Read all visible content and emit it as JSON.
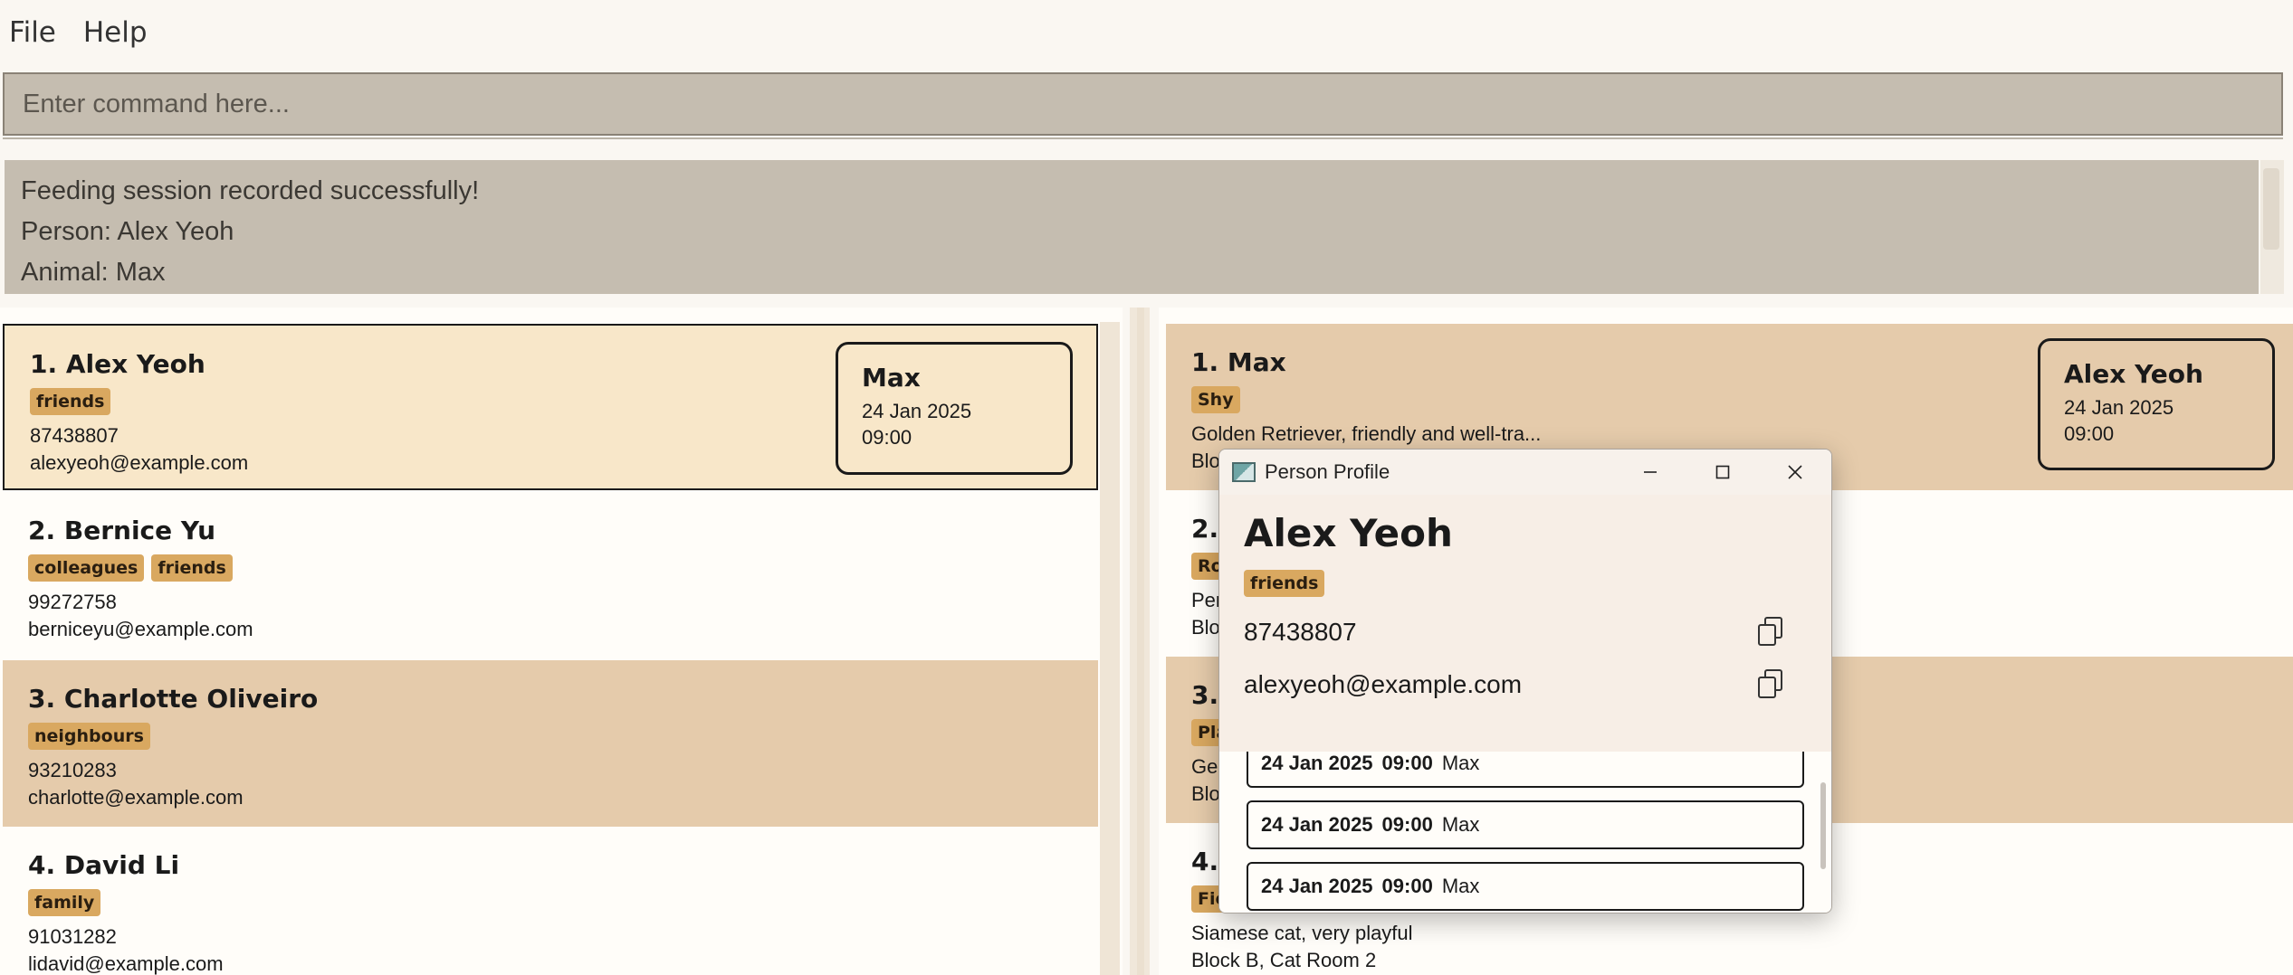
{
  "menu": {
    "file": "File",
    "help": "Help"
  },
  "command": {
    "placeholder": "Enter command here..."
  },
  "result": {
    "line1": "Feeding session recorded successfully!",
    "line2": "Person: Alex Yeoh",
    "line3": "Animal: Max"
  },
  "persons": [
    {
      "index_name": "1. Alex Yeoh",
      "tags": [
        "friends"
      ],
      "phone": "87438807",
      "email": "alexyeoh@example.com",
      "feed": {
        "animal": "Max",
        "date": "24 Jan 2025",
        "time": "09:00"
      }
    },
    {
      "index_name": "2. Bernice Yu",
      "tags": [
        "colleagues",
        "friends"
      ],
      "phone": "99272758",
      "email": "berniceyu@example.com"
    },
    {
      "index_name": "3. Charlotte Oliveiro",
      "tags": [
        "neighbours"
      ],
      "phone": "93210283",
      "email": "charlotte@example.com"
    },
    {
      "index_name": "4. David Li",
      "tags": [
        "family"
      ],
      "phone": "91031282",
      "email": "lidavid@example.com"
    }
  ],
  "animals": [
    {
      "index_name": "1. Max",
      "tags": [
        "Shy"
      ],
      "description": "Golden Retriever, friendly and well-tra...",
      "location": "Block A, Dog Run 1",
      "feed": {
        "person": "Alex Yeoh",
        "date": "24 Jan 2025",
        "time": "09:00"
      }
    },
    {
      "index_name": "2.",
      "tag_partial": "Ro",
      "desc_partial": "Per",
      "loc_partial": "Bloc"
    },
    {
      "index_name": "3.",
      "tag_partial": "Pla",
      "desc_partial": "Ger",
      "loc_partial": "Bloc"
    },
    {
      "index_name": "4.",
      "tag_partial": "Fie",
      "description": "Siamese cat, very playful",
      "location": "Block B, Cat Room 2"
    }
  ],
  "popup": {
    "window_title": "Person Profile",
    "name": "Alex Yeoh",
    "tag": "friends",
    "phone": "87438807",
    "email": "alexyeoh@example.com",
    "feedings": [
      {
        "date": "24 Jan 2025",
        "time": "09:00",
        "animal": "Max"
      },
      {
        "date": "24 Jan 2025",
        "time": "09:00",
        "animal": "Max"
      },
      {
        "date": "24 Jan 2025",
        "time": "09:00",
        "animal": "Max"
      }
    ]
  }
}
